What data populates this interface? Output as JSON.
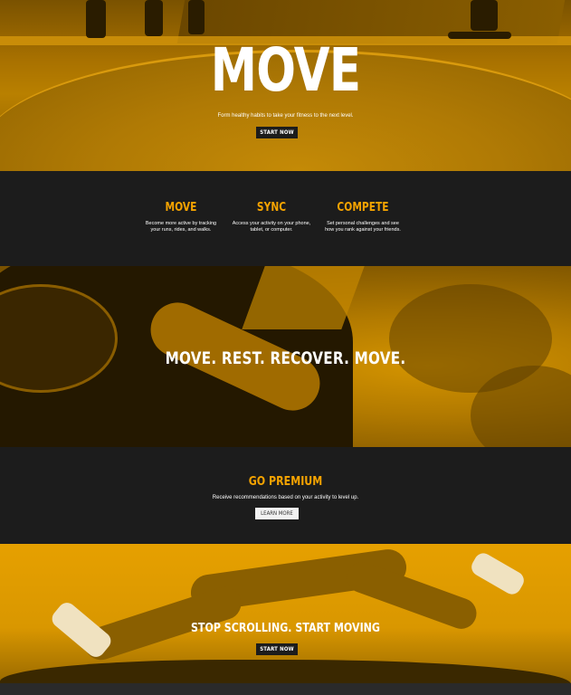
{
  "hero": {
    "title": "MOVE",
    "subtitle": "Form healthy habits to take your fitness to the next level.",
    "button_label": "START NOW"
  },
  "features": [
    {
      "title": "MOVE",
      "description_line1": "Become more active by tracking",
      "description_line2": "your runs, rides, and walks."
    },
    {
      "title": "SYNC",
      "description_line1": "Access your activity on your phone,",
      "description_line2": "tablet, or computer."
    },
    {
      "title": "COMPETE",
      "description_line1": "Set personal challenges and see",
      "description_line2": "how you rank against your friends."
    }
  ],
  "banner": {
    "text": "MOVE. REST. RECOVER. MOVE."
  },
  "premium": {
    "title": "GO PREMIUM",
    "subtitle": "Receive recommendations based on your activity to level up.",
    "button_label": "LEARN MORE"
  },
  "cta": {
    "text": "STOP SCROLLING. START MOVING",
    "button_label": "START NOW"
  },
  "colors": {
    "accent": "#f5a300",
    "dark_bg": "#1c1c1c",
    "text_light": "#ffffff"
  }
}
